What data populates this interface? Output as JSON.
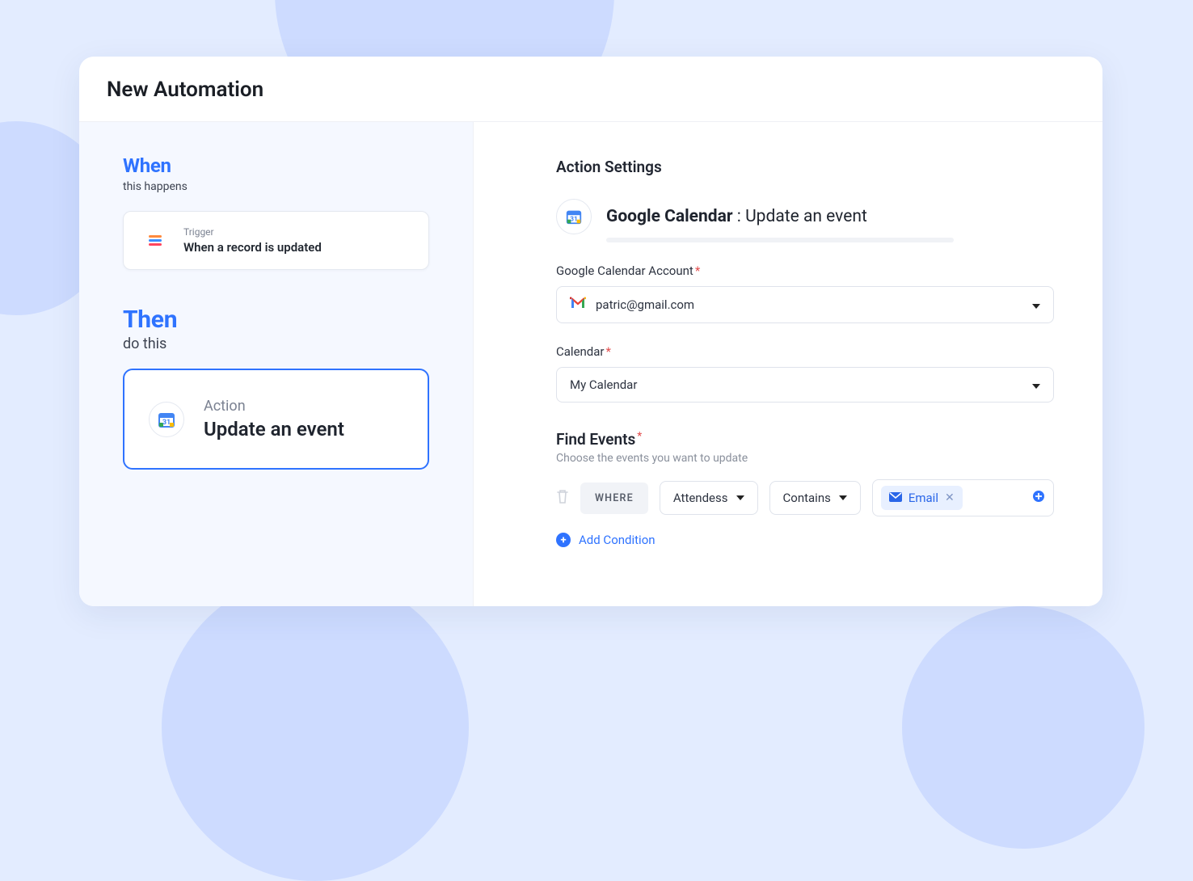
{
  "page_title": "New Automation",
  "left": {
    "when": {
      "title": "When",
      "sub": "this happens"
    },
    "trigger": {
      "label": "Trigger",
      "name": "When a record is updated"
    },
    "then": {
      "title": "Then",
      "sub": "do this"
    },
    "action": {
      "label": "Action",
      "name": "Update an event"
    }
  },
  "right": {
    "heading": "Action Settings",
    "service_name": "Google Calendar",
    "service_sep": " : ",
    "service_action": "Update an event",
    "fields": {
      "account_label": "Google Calendar Account",
      "account_value": "patric@gmail.com",
      "calendar_label": "Calendar",
      "calendar_value": "My Calendar"
    },
    "find_events": {
      "title": "Find Events",
      "hint": "Choose the events you want to update",
      "where": "WHERE",
      "field": "Attendess",
      "operator": "Contains",
      "value_tag": "Email",
      "add_condition": "Add Condition"
    }
  }
}
